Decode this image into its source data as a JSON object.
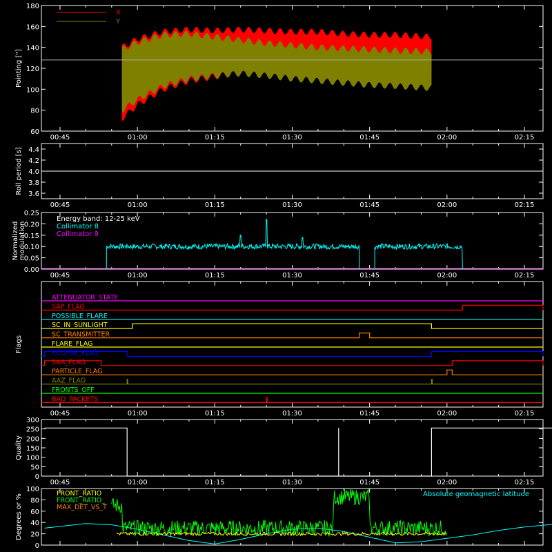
{
  "time_ticks": [
    "00:45",
    "01:00",
    "01:15",
    "01:30",
    "01:45",
    "02:00",
    "02:15"
  ],
  "chart_data": [
    {
      "id": "pointing",
      "type": "line",
      "ylabel": "Pointing [\"]",
      "ylim": [
        60,
        180
      ],
      "yticks": [
        "60",
        "80",
        "100",
        "120",
        "140",
        "160",
        "180"
      ],
      "legend": [
        {
          "name": "X",
          "color": "#ff0000"
        },
        {
          "name": "Y",
          "color": "#808000"
        }
      ],
      "reference_line": 128,
      "series": [
        {
          "name": "X",
          "color": "#ff0000",
          "x": [
            "00:57",
            "01:00",
            "01:05",
            "01:10",
            "01:15",
            "01:20",
            "01:25",
            "01:30",
            "01:35",
            "01:40",
            "01:45",
            "01:50",
            "01:57"
          ],
          "upper": [
            140,
            148,
            155,
            157,
            156,
            157,
            156,
            155,
            155,
            153,
            152,
            152,
            150
          ],
          "lower": [
            72,
            85,
            100,
            108,
            112,
            116,
            118,
            118,
            117,
            117,
            116,
            116,
            115
          ]
        },
        {
          "name": "Y",
          "color": "#808000",
          "x": [
            "00:57",
            "01:00",
            "01:05",
            "01:10",
            "01:15",
            "01:20",
            "01:25",
            "01:30",
            "01:35",
            "01:40",
            "01:45",
            "01:50",
            "01:57"
          ],
          "upper": [
            138,
            145,
            152,
            153,
            150,
            147,
            144,
            142,
            140,
            139,
            138,
            137,
            136
          ],
          "lower": [
            80,
            90,
            103,
            110,
            113,
            115,
            113,
            110,
            108,
            106,
            104,
            103,
            101
          ]
        }
      ]
    },
    {
      "id": "roll",
      "type": "line",
      "ylabel": "Roll period [s]",
      "ylim": [
        3.5,
        4.5
      ],
      "yticks": [
        "3.6",
        "3.8",
        "4.0",
        "4.2",
        "4.4"
      ],
      "series": [
        {
          "name": "",
          "color": "#ffffff",
          "x": [
            "00:42",
            "02:22"
          ],
          "y": [
            4.0,
            4.0
          ]
        }
      ]
    },
    {
      "id": "modulation",
      "type": "line",
      "ylabel": "Normalized modulation",
      "ylim": [
        0,
        0.25
      ],
      "yticks": [
        "0.00",
        "0.05",
        "0.10",
        "0.15",
        "0.20",
        "0.25"
      ],
      "legend": [
        {
          "name": "Energy band: 12-25 keV",
          "color": "#ffffff"
        },
        {
          "name": "Collimator 8",
          "color": "#00ffff"
        },
        {
          "name": "Collimator 9",
          "color": "#ff00ff"
        }
      ],
      "series": [
        {
          "name": "Collimator 8",
          "color": "#00ffff",
          "segments": [
            {
              "x0": "00:54",
              "x1": "01:43",
              "base": 0.1,
              "noise": 0.012,
              "spikes": [
                [
                  "01:25",
                  0.22
                ],
                [
                  "01:20",
                  0.15
                ],
                [
                  "01:32",
                  0.14
                ]
              ]
            },
            {
              "x0": "01:46",
              "x1": "02:03",
              "base": 0.1,
              "noise": 0.012,
              "spikes": []
            }
          ]
        },
        {
          "name": "Collimator 9",
          "color": "#ff00ff",
          "x": [
            "00:42",
            "02:22"
          ],
          "y": [
            0,
            0
          ]
        }
      ]
    },
    {
      "id": "flags",
      "type": "line",
      "ylabel": "Flags",
      "flags": [
        {
          "label": "ATTENUATOR_STATE",
          "color": "#ff00ff",
          "high": []
        },
        {
          "label": "SAP_FLAG",
          "color": "#ff0000",
          "high": [
            [
              "02:03",
              "02:22"
            ]
          ]
        },
        {
          "label": "POSSIBLE_FLARE",
          "color": "#00ffff",
          "high": []
        },
        {
          "label": "SC_IN_SUNLIGHT",
          "color": "#ffff00",
          "high": [
            [
              "00:59",
              "01:57"
            ]
          ]
        },
        {
          "label": "SC_TRANSMITTER",
          "color": "#ff8000",
          "high": [
            [
              "01:43",
              "01:45"
            ]
          ]
        },
        {
          "label": "FLARE_FLAG",
          "color": "#ffff00",
          "high": []
        },
        {
          "label": "ECLIPSE_FLAG",
          "color": "#0000ff",
          "high": [
            [
              "00:42",
              "00:58"
            ],
            [
              "01:57",
              "02:22"
            ]
          ]
        },
        {
          "label": "SAA_FLAG",
          "color": "#ff0000",
          "high": [
            [
              "00:42",
              "00:53"
            ],
            [
              "02:01",
              "02:22"
            ]
          ]
        },
        {
          "label": "PARTICLE_FLAG",
          "color": "#ff8000",
          "high": [
            [
              "02:00",
              "02:01"
            ]
          ]
        },
        {
          "label": "AAZ_FLAG",
          "color": "#808000",
          "high": [
            [
              "00:58",
              "00:58"
            ],
            [
              "01:57",
              "01:57"
            ]
          ]
        },
        {
          "label": "FRONTS_OFF",
          "color": "#00ff00",
          "high": []
        },
        {
          "label": "BAD_PACKETS",
          "color": "#ff0000",
          "high": [
            [
              "01:25",
              "01:25"
            ]
          ]
        }
      ]
    },
    {
      "id": "quality",
      "type": "line",
      "ylabel": "Quality",
      "ylim": [
        0,
        300
      ],
      "yticks": [
        "0",
        "50",
        "100",
        "150",
        "200",
        "250",
        "300"
      ],
      "series": [
        {
          "name": "",
          "color": "#ffffff",
          "steps": [
            [
              "00:42",
              255
            ],
            [
              "00:58",
              255
            ],
            [
              "00:58",
              0
            ],
            [
              "01:39",
              0
            ],
            [
              "01:39",
              255
            ],
            [
              "01:39",
              0
            ],
            [
              "01:57",
              0
            ],
            [
              "01:57",
              255
            ],
            [
              "02:22",
              255
            ]
          ]
        }
      ]
    },
    {
      "id": "latitude",
      "type": "line",
      "ylabel": "Degrees or %",
      "ylim": [
        0,
        100
      ],
      "yticks": [
        "0",
        "20",
        "40",
        "60",
        "80",
        "100"
      ],
      "legend": [
        {
          "name": "FRONT_RATIO",
          "color": "#ffff00"
        },
        {
          "name": "FRONT_RATIO_",
          "color": "#00ff00"
        },
        {
          "name": "MAX_DET_VS_T",
          "color": "#ff8000"
        }
      ],
      "annotation": {
        "text": "Absolute geomagnetic latitude",
        "color": "#00ffff"
      },
      "series": [
        {
          "name": "Absolute geomagnetic latitude",
          "color": "#00ffff",
          "x": [
            "00:42",
            "00:50",
            "00:55",
            "01:00",
            "01:05",
            "01:10",
            "01:15",
            "01:20",
            "01:25",
            "01:30",
            "01:35",
            "01:40",
            "01:45",
            "01:50",
            "01:55",
            "02:00",
            "02:05",
            "02:10",
            "02:15",
            "02:22"
          ],
          "y": [
            30,
            38,
            36,
            28,
            18,
            8,
            2,
            10,
            20,
            28,
            30,
            24,
            14,
            4,
            6,
            12,
            18,
            26,
            32,
            38
          ]
        },
        {
          "name": "FRONT_RATIO",
          "color": "#ffff00",
          "x0": "00:56",
          "x1": "02:00",
          "base": 20
        },
        {
          "name": "FRONT_RATIO_",
          "color": "#00ff00",
          "x0": "00:55",
          "x1": "02:00",
          "base": 30
        }
      ]
    }
  ]
}
